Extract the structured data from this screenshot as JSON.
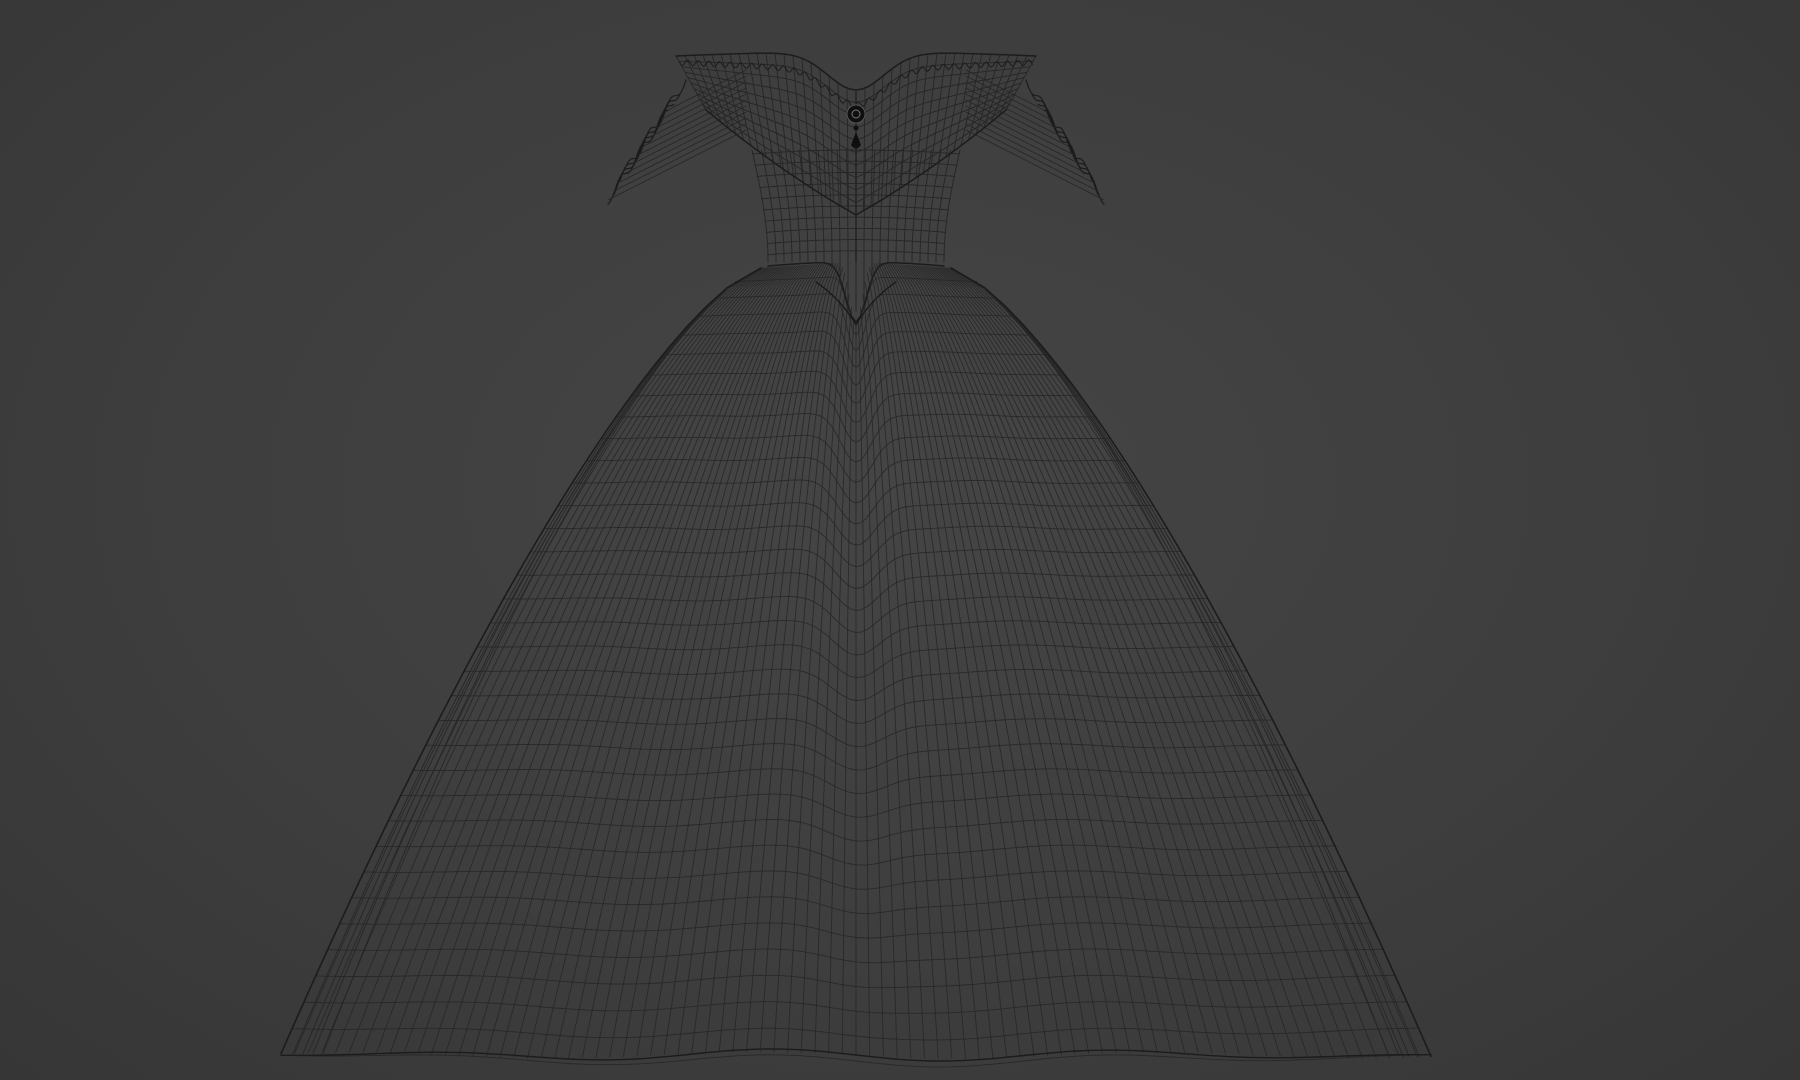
{
  "viewport": {
    "background_color": "#3d3d3d",
    "wire_color": "#262626",
    "outline_color": "#1c1c1c",
    "brooch_color": "#0f0f0f"
  },
  "model": {
    "subject": "ball-gown-wireframe-mesh",
    "parts": [
      "bodice",
      "collar",
      "sleeve-ruffle-left",
      "sleeve-ruffle-right",
      "skirt",
      "brooch"
    ]
  }
}
